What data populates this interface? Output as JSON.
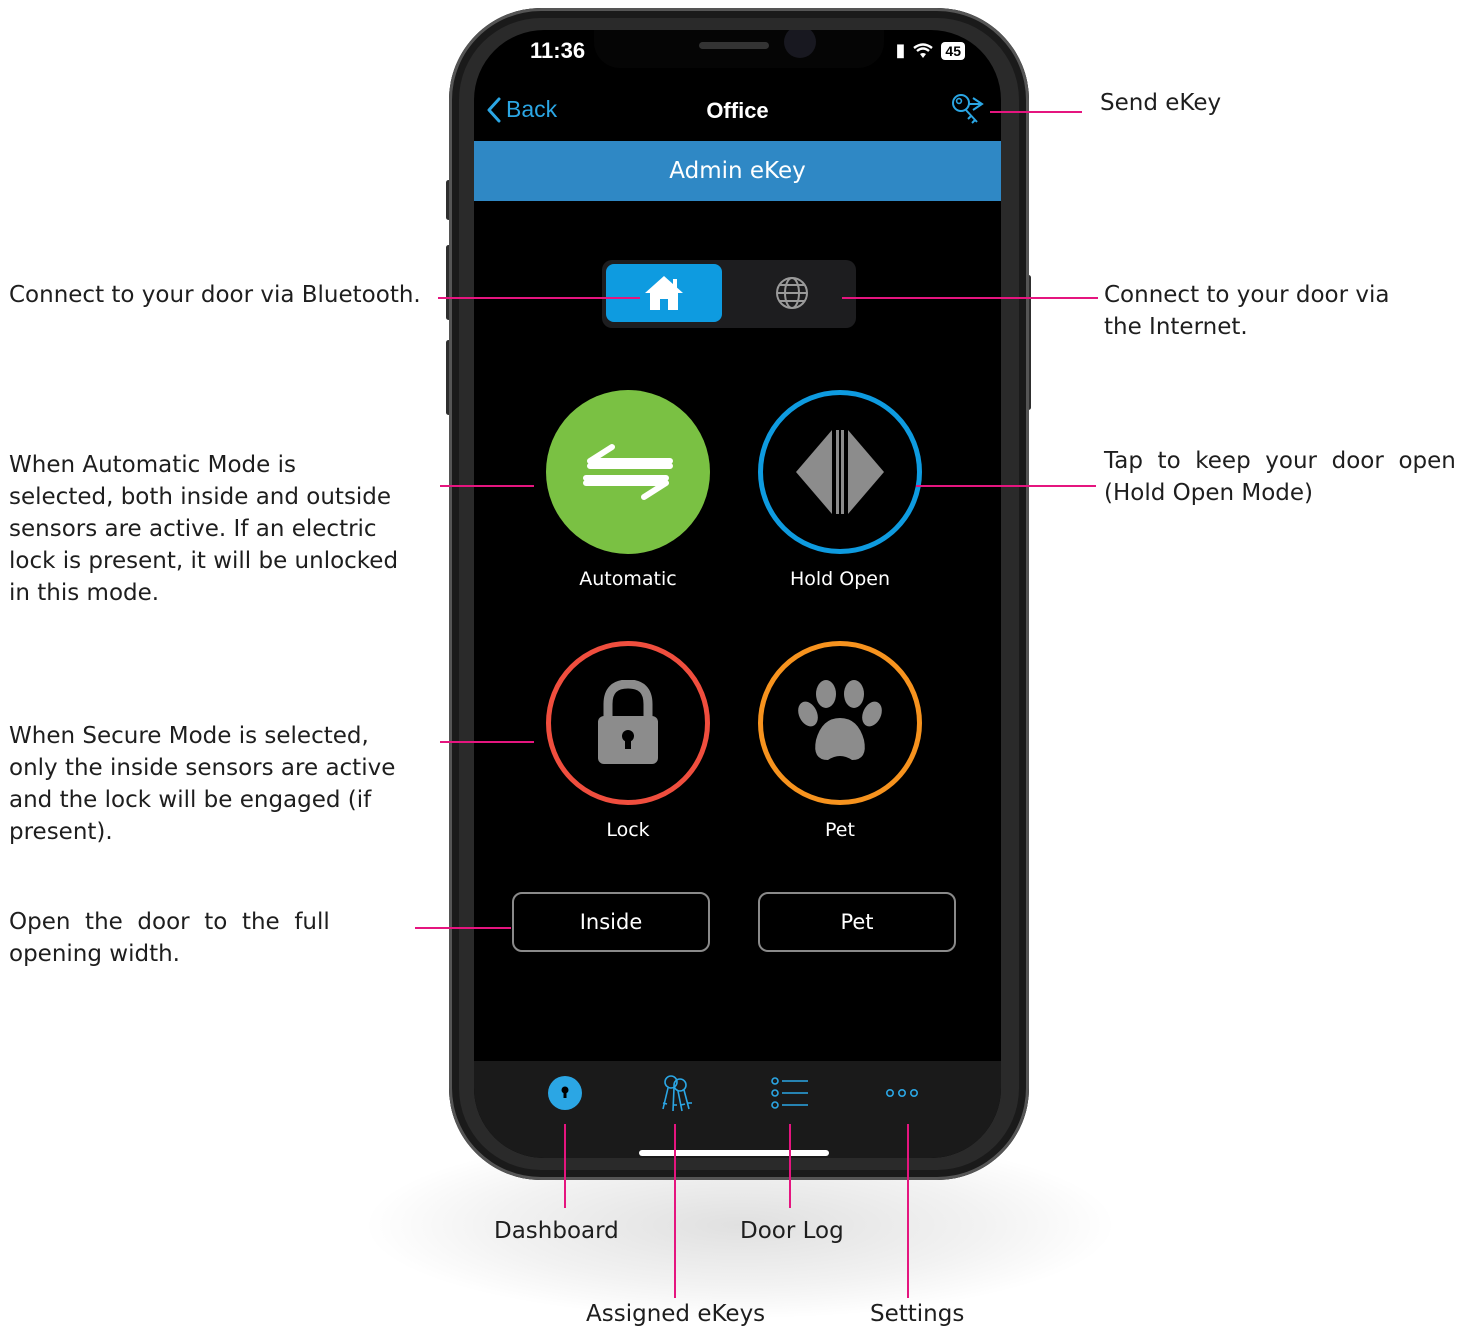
{
  "status_bar": {
    "time": "11:36",
    "battery": "45"
  },
  "nav": {
    "back_label": "Back",
    "title": "Office"
  },
  "banner": {
    "text": "Admin eKey"
  },
  "connection_toggle": {
    "selected": "bluetooth"
  },
  "modes": {
    "automatic_label": "Automatic",
    "hold_open_label": "Hold Open",
    "lock_label": "Lock",
    "pet_label": "Pet"
  },
  "actions": {
    "inside_label": "Inside",
    "pet_label": "Pet"
  },
  "tabs": {
    "selected": "dashboard"
  },
  "colors": {
    "accent": "#2ba6e4",
    "banner": "#2f88c5",
    "automatic": "#7ac143",
    "hold_open": "#0e9be0",
    "lock": "#f04e3e",
    "pet": "#f7931e",
    "annotation_line": "#e5157f"
  },
  "annotations": {
    "send_ekey": "Send eKey",
    "bluetooth": "Connect to your door via Bluetooth.",
    "internet_1": "Connect to your door via",
    "internet_2": "the Internet.",
    "automatic_1": "When Automatic Mode is",
    "automatic_2": "selected, both inside and outside",
    "automatic_3": "sensors are active. If an electric",
    "automatic_4": "lock is present, it will be unlocked",
    "automatic_5": "in this mode.",
    "hold_open_1": "Tap  to  keep  your  door  open",
    "hold_open_2": "(Hold Open Mode)",
    "secure_1": "When Secure Mode is selected,",
    "secure_2": "only the inside sensors are active",
    "secure_3": "and the lock will be engaged (if",
    "secure_4": "present).",
    "inside_1": "Open  the  door  to  the  full",
    "inside_2": "opening width.",
    "dashboard": "Dashboard",
    "assigned_ekeys": "Assigned eKeys",
    "door_log": "Door Log",
    "settings": "Settings"
  }
}
